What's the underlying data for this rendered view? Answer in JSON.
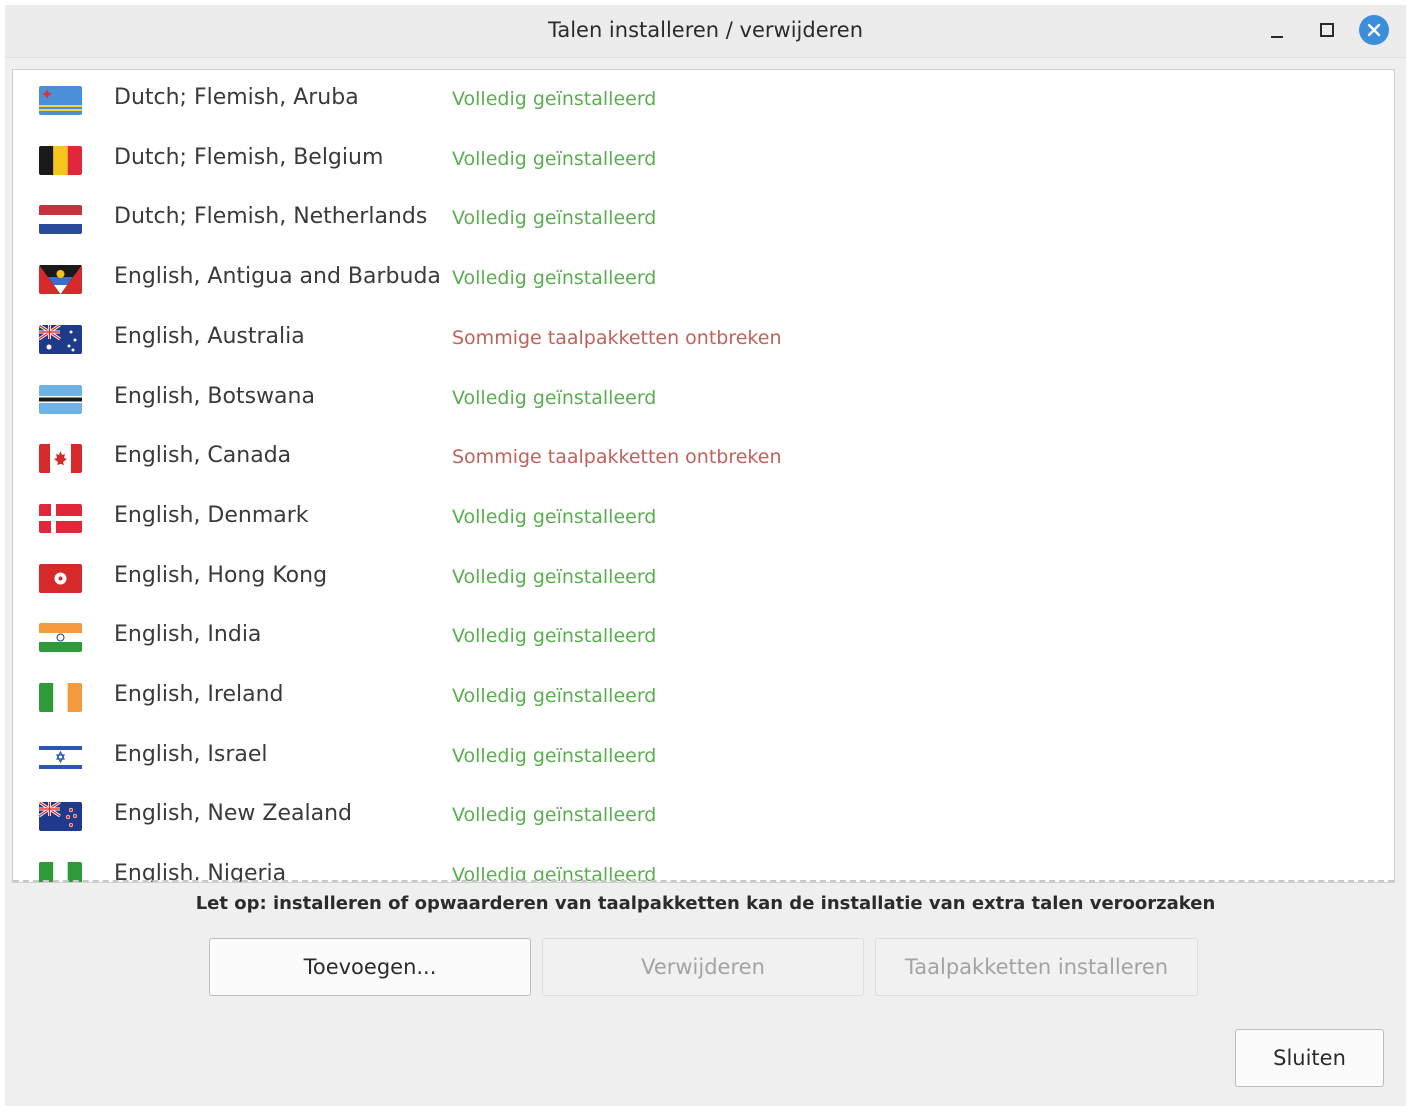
{
  "window": {
    "title": "Talen installeren / verwijderen",
    "close_color": "#3a8edb"
  },
  "colors": {
    "installed": "#5aae4f",
    "missing": "#c0625a"
  },
  "languages": [
    {
      "label": "Dutch; Flemish, Aruba",
      "status": "Volledig geïnstalleerd",
      "state": "installed",
      "flag": "aruba-flag-icon"
    },
    {
      "label": "Dutch; Flemish, Belgium",
      "status": "Volledig geïnstalleerd",
      "state": "installed",
      "flag": "belgium-flag-icon"
    },
    {
      "label": "Dutch; Flemish, Netherlands",
      "status": "Volledig geïnstalleerd",
      "state": "installed",
      "flag": "netherlands-flag-icon"
    },
    {
      "label": "English, Antigua and Barbuda",
      "status": "Volledig geïnstalleerd",
      "state": "installed",
      "flag": "antigua-flag-icon"
    },
    {
      "label": "English, Australia",
      "status": "Sommige taalpakketten ontbreken",
      "state": "missing",
      "flag": "australia-flag-icon"
    },
    {
      "label": "English, Botswana",
      "status": "Volledig geïnstalleerd",
      "state": "installed",
      "flag": "botswana-flag-icon"
    },
    {
      "label": "English, Canada",
      "status": "Sommige taalpakketten ontbreken",
      "state": "missing",
      "flag": "canada-flag-icon"
    },
    {
      "label": "English, Denmark",
      "status": "Volledig geïnstalleerd",
      "state": "installed",
      "flag": "denmark-flag-icon"
    },
    {
      "label": "English, Hong Kong",
      "status": "Volledig geïnstalleerd",
      "state": "installed",
      "flag": "hongkong-flag-icon"
    },
    {
      "label": "English, India",
      "status": "Volledig geïnstalleerd",
      "state": "installed",
      "flag": "india-flag-icon"
    },
    {
      "label": "English, Ireland",
      "status": "Volledig geïnstalleerd",
      "state": "installed",
      "flag": "ireland-flag-icon"
    },
    {
      "label": "English, Israel",
      "status": "Volledig geïnstalleerd",
      "state": "installed",
      "flag": "israel-flag-icon"
    },
    {
      "label": "English, New Zealand",
      "status": "Volledig geïnstalleerd",
      "state": "installed",
      "flag": "newzealand-flag-icon"
    },
    {
      "label": "English, Nigeria",
      "status": "Volledig geïnstalleerd",
      "state": "installed",
      "flag": "nigeria-flag-icon"
    }
  ],
  "note": "Let op: installeren of opwaarderen van taalpakketten kan de installatie van extra talen veroorzaken",
  "buttons": {
    "add": "Toevoegen...",
    "remove": "Verwijderen",
    "install_packs": "Taalpakketten installeren",
    "close": "Sluiten"
  }
}
